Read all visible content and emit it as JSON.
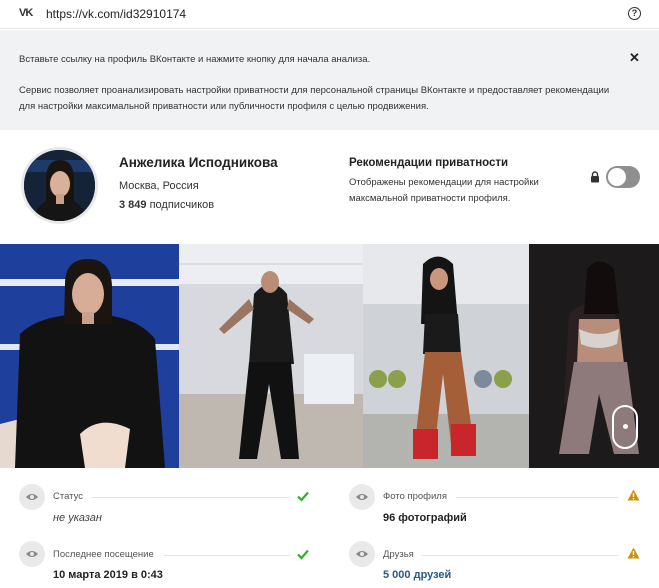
{
  "urlbar": {
    "logo": "VK",
    "url": "https://vk.com/id32910174",
    "help": "?"
  },
  "info": {
    "line1": "Вставьте ссылку на профиль ВКонтакте и нажмите кнопку для начала анализа.",
    "line2": "Сервис позволяет проанализировать настройки приватности для персональной страницы ВКонтакте и предоставляет рекомендации для настройки максимальной приватности или публичности профиля с целью продвижения.",
    "close": "✕"
  },
  "profile": {
    "name": "Анжелика Исподникова",
    "city": "Москва, Россия",
    "subscribers_count": "3 849",
    "subscribers_label": " подписчиков"
  },
  "recommendations": {
    "title": "Рекомендации приватности",
    "description": "Отображены рекомендации для настройки максмальной приватности профиля.",
    "toggle_on": false
  },
  "stats": [
    {
      "label": "Статус",
      "value": "не указан",
      "status": "ok"
    },
    {
      "label": "Фото профиля",
      "value": "96 фотографий",
      "status": "warning"
    },
    {
      "label": "Последнее посещение",
      "value": "10 марта 2019 в 0:43",
      "status": "ok"
    },
    {
      "label": "Друзья",
      "value": "5 000 друзей",
      "status": "warning"
    }
  ],
  "colors": {
    "ok": "#2db22d",
    "warning": "#c9900a",
    "link": "#2a5885",
    "toggle_off": "#8f8f8f"
  },
  "icons": {
    "eye": "eye-icon",
    "lock": "lock-icon",
    "check": "check-icon",
    "warning": "warning-icon",
    "close": "close-icon",
    "help": "help-icon"
  }
}
